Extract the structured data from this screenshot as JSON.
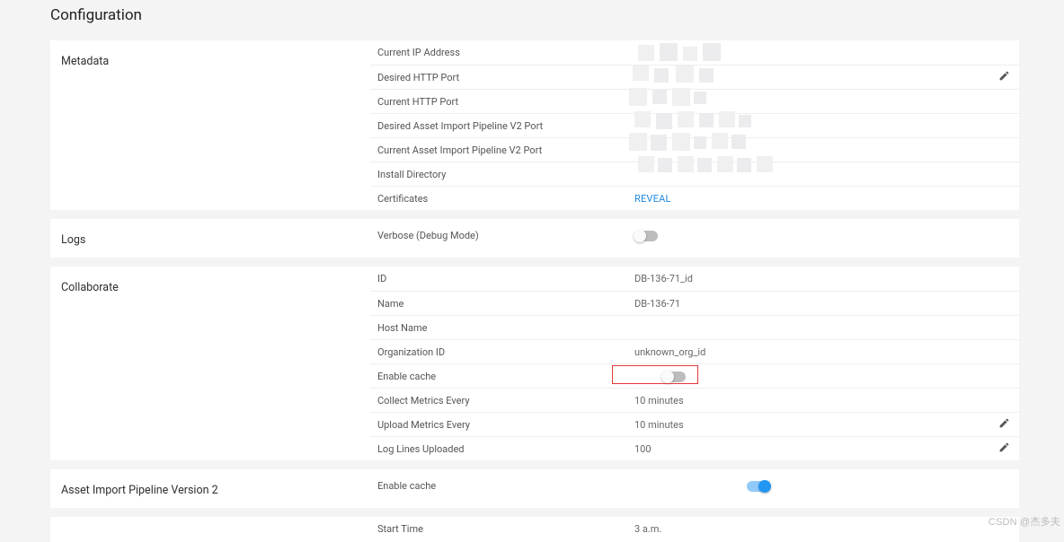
{
  "page": {
    "title": "Configuration"
  },
  "sections": {
    "metadata": {
      "title": "Metadata",
      "rows": {
        "current_ip": {
          "label": "Current IP Address"
        },
        "desired_http": {
          "label": "Desired HTTP Port"
        },
        "current_http": {
          "label": "Current HTTP Port"
        },
        "desired_v2": {
          "label": "Desired Asset Import Pipeline V2 Port"
        },
        "current_v2": {
          "label": "Current Asset Import Pipeline V2 Port"
        },
        "install_dir": {
          "label": "Install Directory"
        },
        "certs": {
          "label": "Certificates",
          "value": "REVEAL"
        }
      }
    },
    "logs": {
      "title": "Logs",
      "rows": {
        "verbose": {
          "label": "Verbose (Debug Mode)",
          "on": false
        }
      }
    },
    "collaborate": {
      "title": "Collaborate",
      "rows": {
        "id": {
          "label": "ID",
          "value": "DB-136-71_id"
        },
        "name": {
          "label": "Name",
          "value": "DB-136-71"
        },
        "host": {
          "label": "Host Name",
          "value": ""
        },
        "org": {
          "label": "Organization ID",
          "value": "unknown_org_id"
        },
        "cache": {
          "label": "Enable cache",
          "on": false
        },
        "collect": {
          "label": "Collect Metrics Every",
          "value": "10 minutes"
        },
        "upload": {
          "label": "Upload Metrics Every",
          "value": "10 minutes"
        },
        "lines": {
          "label": "Log Lines Uploaded",
          "value": "100"
        }
      }
    },
    "aipv2": {
      "title": "Asset Import Pipeline Version 2",
      "rows": {
        "cache": {
          "label": "Enable cache",
          "on": true
        }
      }
    },
    "next": {
      "rows": {
        "start": {
          "label": "Start Time",
          "value": "3 a.m."
        }
      }
    }
  },
  "watermark": "CSDN @杰多夫"
}
